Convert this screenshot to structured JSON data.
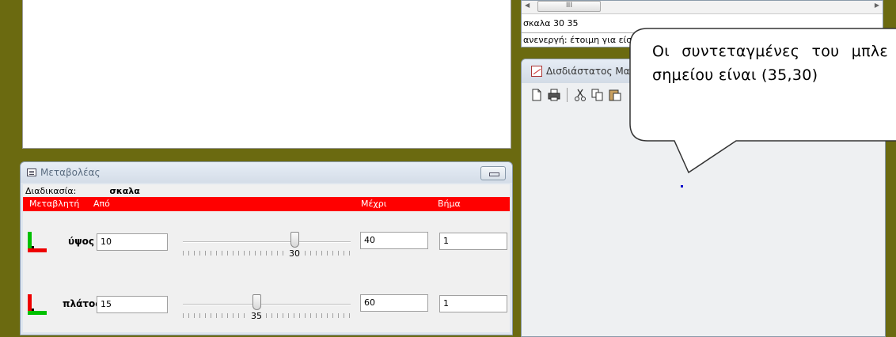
{
  "variator": {
    "title": "Μεταβολέας",
    "process_label": "Διαδικασία:",
    "process_value": "σκαλα",
    "headers": {
      "variable": "Μεταβλητή",
      "from": "Από",
      "to": "Μέχρι",
      "step": "Βήμα"
    },
    "rows": [
      {
        "name": "ύψος",
        "from": "10",
        "slider_value": "30",
        "to": "40",
        "step": "1"
      },
      {
        "name": "πλάτος",
        "from": "15",
        "slider_value": "35",
        "to": "60",
        "step": "1"
      }
    ]
  },
  "command": {
    "scroll_thumb_label": "III",
    "line": "σκαλα 30 35",
    "status": "ανενεργή: έτοιμη για είσ"
  },
  "map_window": {
    "title": "Δισδιάστατος Μα"
  },
  "callout": {
    "text": "Οι συντεταγμένες του μπλε σημείου είναι (35,30)"
  },
  "colors": {
    "background": "#6b6a10",
    "header_red": "#ff0000",
    "dot_blue": "#0000cc"
  }
}
